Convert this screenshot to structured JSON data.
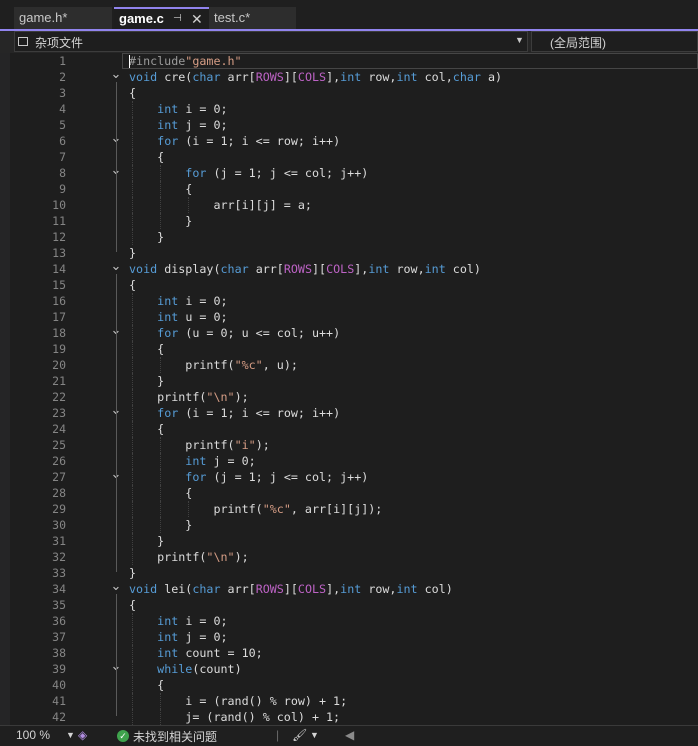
{
  "tabs": [
    {
      "label": "game.h*",
      "active": false
    },
    {
      "label": "game.c",
      "active": true,
      "pin": "⊣",
      "close": "✕"
    },
    {
      "label": "test.c*",
      "active": false
    }
  ],
  "nav": {
    "project": "杂项文件",
    "scope": "(全局范围)"
  },
  "code_lines": [
    "#include\"game.h\"",
    "void cre(char arr[ROWS][COLS],int row,int col,char a)",
    "{",
    "    int i = 0;",
    "    int j = 0;",
    "    for (i = 1; i <= row; i++)",
    "    {",
    "        for (j = 1; j <= col; j++)",
    "        {",
    "            arr[i][j] = a;",
    "        }",
    "    }",
    "}",
    "void display(char arr[ROWS][COLS],int row,int col)",
    "{",
    "    int i = 0;",
    "    int u = 0;",
    "    for (u = 0; u <= col; u++)",
    "    {",
    "        printf(\"%c\", u);",
    "    }",
    "    printf(\"\\n\");",
    "    for (i = 1; i <= row; i++)",
    "    {",
    "        printf(\"i\");",
    "        int j = 0;",
    "        for (j = 1; j <= col; j++)",
    "        {",
    "            printf(\"%c\", arr[i][j]);",
    "        }",
    "    }",
    "    printf(\"\\n\");",
    "}",
    "void lei(char arr[ROWS][COLS],int row,int col)",
    "{",
    "    int i = 0;",
    "    int j = 0;",
    "    int count = 10;",
    "    while(count)",
    "    {",
    "        i = (rand() % row) + 1;",
    "        j= (rand() % col) + 1;"
  ],
  "fold_lines": [
    2,
    6,
    8,
    14,
    18,
    23,
    27,
    34,
    39
  ],
  "status": {
    "zoom": "100 %",
    "issues": "未找到相关问题"
  },
  "colors": {
    "accent": "#9184ee",
    "keyword": "#569cd6",
    "string": "#d69d85",
    "macro": "#bd63c5",
    "ok": "#3fa34d"
  }
}
